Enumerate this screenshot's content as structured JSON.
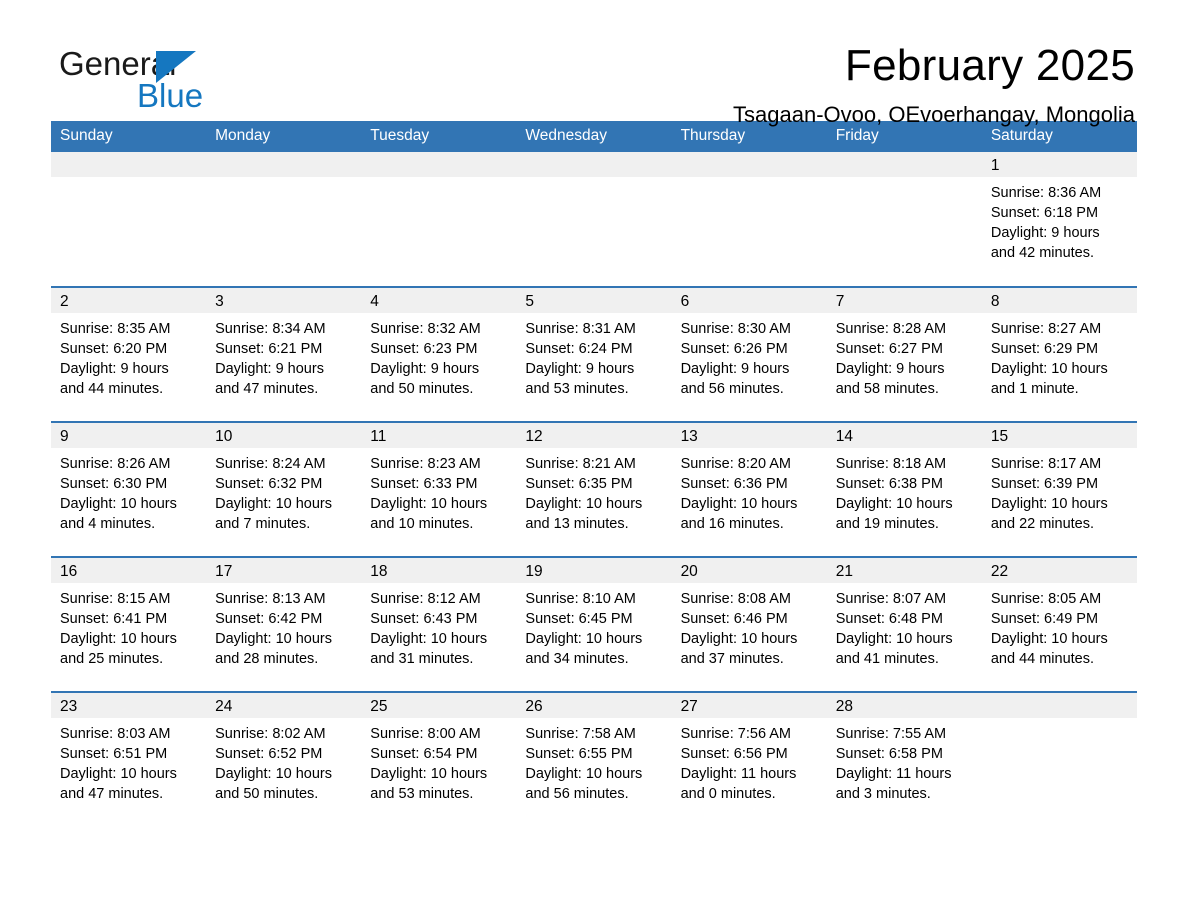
{
  "logo": {
    "word_one": "General",
    "word_two": "Blue",
    "triangle_icon": "triangle-icon",
    "brand_color": "#1577c0"
  },
  "header": {
    "title": "February 2025",
    "location": "Tsagaan-Ovoo, OEvoerhangay, Mongolia"
  },
  "theme": {
    "header_blue": "#3275b4",
    "date_band_gray": "#f0f0f0",
    "text_black": "#000000"
  },
  "calendar": {
    "weekday_headers": [
      "Sunday",
      "Monday",
      "Tuesday",
      "Wednesday",
      "Thursday",
      "Friday",
      "Saturday"
    ],
    "weeks": [
      [
        {
          "date": "",
          "sunrise": "",
          "sunset": "",
          "daylight_line1": "",
          "daylight_line2": ""
        },
        {
          "date": "",
          "sunrise": "",
          "sunset": "",
          "daylight_line1": "",
          "daylight_line2": ""
        },
        {
          "date": "",
          "sunrise": "",
          "sunset": "",
          "daylight_line1": "",
          "daylight_line2": ""
        },
        {
          "date": "",
          "sunrise": "",
          "sunset": "",
          "daylight_line1": "",
          "daylight_line2": ""
        },
        {
          "date": "",
          "sunrise": "",
          "sunset": "",
          "daylight_line1": "",
          "daylight_line2": ""
        },
        {
          "date": "",
          "sunrise": "",
          "sunset": "",
          "daylight_line1": "",
          "daylight_line2": ""
        },
        {
          "date": "1",
          "sunrise": "Sunrise: 8:36 AM",
          "sunset": "Sunset: 6:18 PM",
          "daylight_line1": "Daylight: 9 hours",
          "daylight_line2": "and 42 minutes."
        }
      ],
      [
        {
          "date": "2",
          "sunrise": "Sunrise: 8:35 AM",
          "sunset": "Sunset: 6:20 PM",
          "daylight_line1": "Daylight: 9 hours",
          "daylight_line2": "and 44 minutes."
        },
        {
          "date": "3",
          "sunrise": "Sunrise: 8:34 AM",
          "sunset": "Sunset: 6:21 PM",
          "daylight_line1": "Daylight: 9 hours",
          "daylight_line2": "and 47 minutes."
        },
        {
          "date": "4",
          "sunrise": "Sunrise: 8:32 AM",
          "sunset": "Sunset: 6:23 PM",
          "daylight_line1": "Daylight: 9 hours",
          "daylight_line2": "and 50 minutes."
        },
        {
          "date": "5",
          "sunrise": "Sunrise: 8:31 AM",
          "sunset": "Sunset: 6:24 PM",
          "daylight_line1": "Daylight: 9 hours",
          "daylight_line2": "and 53 minutes."
        },
        {
          "date": "6",
          "sunrise": "Sunrise: 8:30 AM",
          "sunset": "Sunset: 6:26 PM",
          "daylight_line1": "Daylight: 9 hours",
          "daylight_line2": "and 56 minutes."
        },
        {
          "date": "7",
          "sunrise": "Sunrise: 8:28 AM",
          "sunset": "Sunset: 6:27 PM",
          "daylight_line1": "Daylight: 9 hours",
          "daylight_line2": "and 58 minutes."
        },
        {
          "date": "8",
          "sunrise": "Sunrise: 8:27 AM",
          "sunset": "Sunset: 6:29 PM",
          "daylight_line1": "Daylight: 10 hours",
          "daylight_line2": "and 1 minute."
        }
      ],
      [
        {
          "date": "9",
          "sunrise": "Sunrise: 8:26 AM",
          "sunset": "Sunset: 6:30 PM",
          "daylight_line1": "Daylight: 10 hours",
          "daylight_line2": "and 4 minutes."
        },
        {
          "date": "10",
          "sunrise": "Sunrise: 8:24 AM",
          "sunset": "Sunset: 6:32 PM",
          "daylight_line1": "Daylight: 10 hours",
          "daylight_line2": "and 7 minutes."
        },
        {
          "date": "11",
          "sunrise": "Sunrise: 8:23 AM",
          "sunset": "Sunset: 6:33 PM",
          "daylight_line1": "Daylight: 10 hours",
          "daylight_line2": "and 10 minutes."
        },
        {
          "date": "12",
          "sunrise": "Sunrise: 8:21 AM",
          "sunset": "Sunset: 6:35 PM",
          "daylight_line1": "Daylight: 10 hours",
          "daylight_line2": "and 13 minutes."
        },
        {
          "date": "13",
          "sunrise": "Sunrise: 8:20 AM",
          "sunset": "Sunset: 6:36 PM",
          "daylight_line1": "Daylight: 10 hours",
          "daylight_line2": "and 16 minutes."
        },
        {
          "date": "14",
          "sunrise": "Sunrise: 8:18 AM",
          "sunset": "Sunset: 6:38 PM",
          "daylight_line1": "Daylight: 10 hours",
          "daylight_line2": "and 19 minutes."
        },
        {
          "date": "15",
          "sunrise": "Sunrise: 8:17 AM",
          "sunset": "Sunset: 6:39 PM",
          "daylight_line1": "Daylight: 10 hours",
          "daylight_line2": "and 22 minutes."
        }
      ],
      [
        {
          "date": "16",
          "sunrise": "Sunrise: 8:15 AM",
          "sunset": "Sunset: 6:41 PM",
          "daylight_line1": "Daylight: 10 hours",
          "daylight_line2": "and 25 minutes."
        },
        {
          "date": "17",
          "sunrise": "Sunrise: 8:13 AM",
          "sunset": "Sunset: 6:42 PM",
          "daylight_line1": "Daylight: 10 hours",
          "daylight_line2": "and 28 minutes."
        },
        {
          "date": "18",
          "sunrise": "Sunrise: 8:12 AM",
          "sunset": "Sunset: 6:43 PM",
          "daylight_line1": "Daylight: 10 hours",
          "daylight_line2": "and 31 minutes."
        },
        {
          "date": "19",
          "sunrise": "Sunrise: 8:10 AM",
          "sunset": "Sunset: 6:45 PM",
          "daylight_line1": "Daylight: 10 hours",
          "daylight_line2": "and 34 minutes."
        },
        {
          "date": "20",
          "sunrise": "Sunrise: 8:08 AM",
          "sunset": "Sunset: 6:46 PM",
          "daylight_line1": "Daylight: 10 hours",
          "daylight_line2": "and 37 minutes."
        },
        {
          "date": "21",
          "sunrise": "Sunrise: 8:07 AM",
          "sunset": "Sunset: 6:48 PM",
          "daylight_line1": "Daylight: 10 hours",
          "daylight_line2": "and 41 minutes."
        },
        {
          "date": "22",
          "sunrise": "Sunrise: 8:05 AM",
          "sunset": "Sunset: 6:49 PM",
          "daylight_line1": "Daylight: 10 hours",
          "daylight_line2": "and 44 minutes."
        }
      ],
      [
        {
          "date": "23",
          "sunrise": "Sunrise: 8:03 AM",
          "sunset": "Sunset: 6:51 PM",
          "daylight_line1": "Daylight: 10 hours",
          "daylight_line2": "and 47 minutes."
        },
        {
          "date": "24",
          "sunrise": "Sunrise: 8:02 AM",
          "sunset": "Sunset: 6:52 PM",
          "daylight_line1": "Daylight: 10 hours",
          "daylight_line2": "and 50 minutes."
        },
        {
          "date": "25",
          "sunrise": "Sunrise: 8:00 AM",
          "sunset": "Sunset: 6:54 PM",
          "daylight_line1": "Daylight: 10 hours",
          "daylight_line2": "and 53 minutes."
        },
        {
          "date": "26",
          "sunrise": "Sunrise: 7:58 AM",
          "sunset": "Sunset: 6:55 PM",
          "daylight_line1": "Daylight: 10 hours",
          "daylight_line2": "and 56 minutes."
        },
        {
          "date": "27",
          "sunrise": "Sunrise: 7:56 AM",
          "sunset": "Sunset: 6:56 PM",
          "daylight_line1": "Daylight: 11 hours",
          "daylight_line2": "and 0 minutes."
        },
        {
          "date": "28",
          "sunrise": "Sunrise: 7:55 AM",
          "sunset": "Sunset: 6:58 PM",
          "daylight_line1": "Daylight: 11 hours",
          "daylight_line2": "and 3 minutes."
        },
        {
          "date": "",
          "sunrise": "",
          "sunset": "",
          "daylight_line1": "",
          "daylight_line2": ""
        }
      ]
    ]
  }
}
